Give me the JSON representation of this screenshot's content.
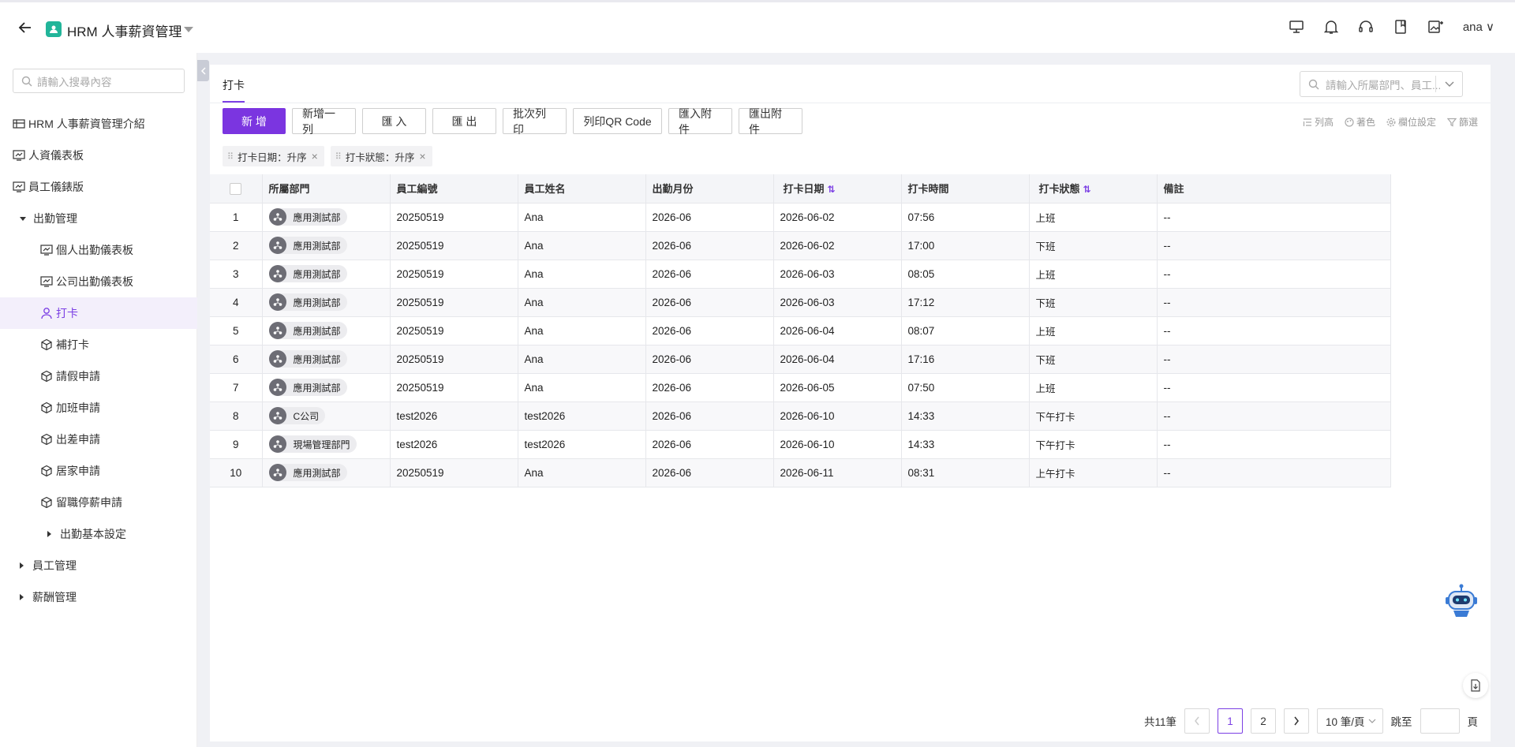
{
  "app": {
    "title": "HRM 人事薪資管理",
    "user": "ana"
  },
  "top_icons": [
    "monitor-icon",
    "bell-icon",
    "headset-icon",
    "book-icon",
    "image-add-icon"
  ],
  "sidebar": {
    "search_placeholder": "請輸入搜尋內容",
    "items": [
      {
        "label": "HRM 人事薪資管理介紹",
        "icon": "table-icon",
        "level": 0
      },
      {
        "label": "人資儀表板",
        "icon": "dashboard-icon",
        "level": 0
      },
      {
        "label": "員工儀錶版",
        "icon": "dashboard-icon",
        "level": 0
      },
      {
        "label": "出勤管理",
        "icon": "caret-down",
        "level": 0
      },
      {
        "label": "個人出勤儀表板",
        "icon": "dashboard-icon",
        "level": 1
      },
      {
        "label": "公司出勤儀表板",
        "icon": "dashboard-icon",
        "level": 1
      },
      {
        "label": "打卡",
        "icon": "user-icon",
        "level": 1,
        "active": true
      },
      {
        "label": "補打卡",
        "icon": "cube-icon",
        "level": 1
      },
      {
        "label": "請假申請",
        "icon": "cube-icon",
        "level": 1
      },
      {
        "label": "加班申請",
        "icon": "cube-icon",
        "level": 1
      },
      {
        "label": "出差申請",
        "icon": "cube-icon",
        "level": 1
      },
      {
        "label": "居家申請",
        "icon": "cube-icon",
        "level": 1
      },
      {
        "label": "留職停薪申請",
        "icon": "cube-icon",
        "level": 1
      },
      {
        "label": "出勤基本設定",
        "icon": "caret-right",
        "level": 2
      },
      {
        "label": "員工管理",
        "icon": "caret-right",
        "level": 0
      },
      {
        "label": "薪酬管理",
        "icon": "caret-right",
        "level": 0
      }
    ]
  },
  "tab": {
    "label": "打卡"
  },
  "search": {
    "placeholder": "請輸入所屬部門、員工..."
  },
  "toolbar": {
    "buttons": [
      "新 增",
      "新增一列",
      "匯 入",
      "匯 出",
      "批次列印",
      "列印QR Code",
      "匯入附件",
      "匯出附件"
    ],
    "tools": [
      "列高",
      "著色",
      "欄位設定",
      "篩選"
    ]
  },
  "sorts": [
    {
      "label": "打卡日期：升序"
    },
    {
      "label": "打卡狀態：升序"
    }
  ],
  "table": {
    "headers": [
      "所屬部門",
      "員工編號",
      "員工姓名",
      "出勤月份",
      "打卡日期",
      "打卡時間",
      "打卡狀態",
      "備註"
    ],
    "rows": [
      [
        "1",
        "應用測試部",
        "20250519",
        "Ana",
        "2026-06",
        "2026-06-02",
        "07:56",
        "上班",
        "--"
      ],
      [
        "2",
        "應用測試部",
        "20250519",
        "Ana",
        "2026-06",
        "2026-06-02",
        "17:00",
        "下班",
        "--"
      ],
      [
        "3",
        "應用測試部",
        "20250519",
        "Ana",
        "2026-06",
        "2026-06-03",
        "08:05",
        "上班",
        "--"
      ],
      [
        "4",
        "應用測試部",
        "20250519",
        "Ana",
        "2026-06",
        "2026-06-03",
        "17:12",
        "下班",
        "--"
      ],
      [
        "5",
        "應用測試部",
        "20250519",
        "Ana",
        "2026-06",
        "2026-06-04",
        "08:07",
        "上班",
        "--"
      ],
      [
        "6",
        "應用測試部",
        "20250519",
        "Ana",
        "2026-06",
        "2026-06-04",
        "17:16",
        "下班",
        "--"
      ],
      [
        "7",
        "應用測試部",
        "20250519",
        "Ana",
        "2026-06",
        "2026-06-05",
        "07:50",
        "上班",
        "--"
      ],
      [
        "8",
        "C公司",
        "test2026",
        "test2026",
        "2026-06",
        "2026-06-10",
        "14:33",
        "下午打卡",
        "--"
      ],
      [
        "9",
        "現場管理部門",
        "test2026",
        "test2026",
        "2026-06",
        "2026-06-10",
        "14:33",
        "下午打卡",
        "--"
      ],
      [
        "10",
        "應用測試部",
        "20250519",
        "Ana",
        "2026-06",
        "2026-06-11",
        "08:31",
        "上午打卡",
        "--"
      ]
    ]
  },
  "pagination": {
    "total": "共11筆",
    "pages": [
      "1",
      "2"
    ],
    "current": "1",
    "page_size": "10 筆/頁",
    "jump_label": "跳至",
    "page_suffix": "頁"
  },
  "colors": {
    "accent": "#7b35e0",
    "app_icon": "#22b59a"
  }
}
